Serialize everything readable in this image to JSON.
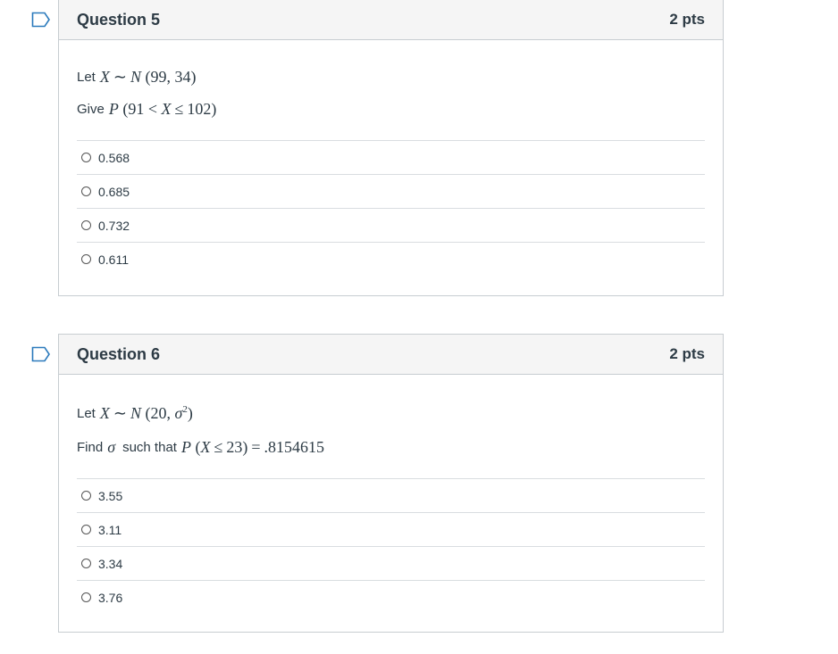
{
  "questions": [
    {
      "title": "Question 5",
      "points": "2 pts",
      "stem": [
        {
          "prefix": "Let",
          "math": {
            "a": "X",
            "op": "∼",
            "b": "N",
            "args": "(99, 34)"
          }
        },
        {
          "prefix": "Give",
          "math": {
            "fn": "P",
            "args_open": "(91 <",
            "var": "X",
            "rel": "≤",
            "args_close": "102)"
          }
        }
      ],
      "answers": [
        "0.568",
        "0.685",
        "0.732",
        "0.611"
      ]
    },
    {
      "title": "Question 6",
      "points": "2 pts",
      "stem": [
        {
          "prefix": "Let",
          "math": {
            "a": "X",
            "op": "∼",
            "b": "N",
            "args_open": "(20,",
            "sigma": "σ",
            "sup": "2",
            "args_close": ")"
          }
        },
        {
          "prefix": "Find",
          "sigma": "σ",
          "middle": "such that",
          "math": {
            "fn": "P",
            "var": "X",
            "rel": "≤",
            "num": "23)",
            "eq": "=",
            "val": ".8154615"
          }
        }
      ],
      "answers": [
        "3.55",
        "3.11",
        "3.34",
        "3.76"
      ]
    }
  ]
}
